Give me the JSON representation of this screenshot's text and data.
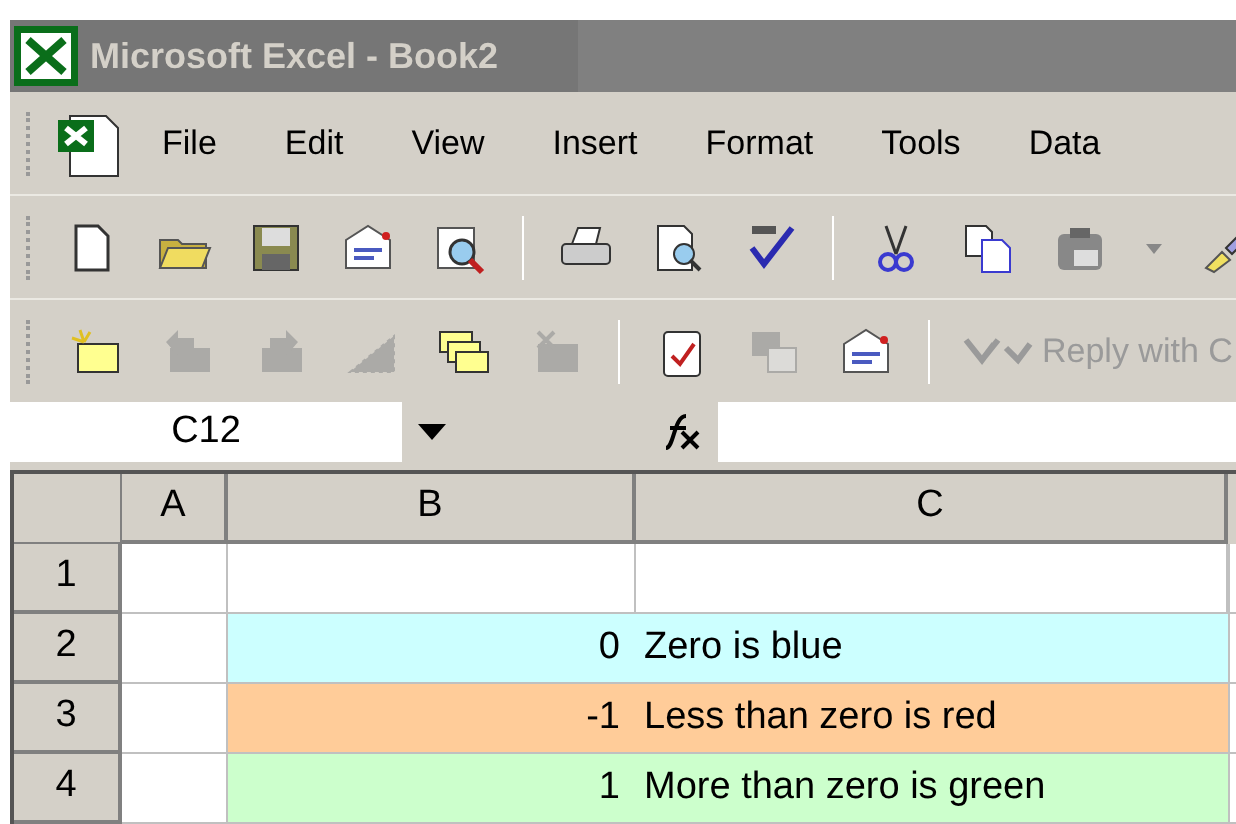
{
  "window": {
    "title": "Microsoft Excel - Book2",
    "active": false
  },
  "menu": [
    "File",
    "Edit",
    "View",
    "Insert",
    "Format",
    "Tools",
    "Data"
  ],
  "toolbar_standard": [
    {
      "kind": "new"
    },
    {
      "kind": "open"
    },
    {
      "kind": "save"
    },
    {
      "kind": "mail"
    },
    {
      "kind": "research"
    },
    {
      "kind": "separator"
    },
    {
      "kind": "print"
    },
    {
      "kind": "preview"
    },
    {
      "kind": "spelling"
    },
    {
      "kind": "separator"
    },
    {
      "kind": "cut"
    },
    {
      "kind": "copy"
    },
    {
      "kind": "paste"
    },
    {
      "kind": "dropdown"
    },
    {
      "kind": "brush"
    }
  ],
  "toolbar_reviewing": [
    {
      "kind": "comment",
      "disabled": false
    },
    {
      "kind": "previous",
      "disabled": true
    },
    {
      "kind": "next",
      "disabled": true
    },
    {
      "kind": "show",
      "disabled": true
    },
    {
      "kind": "showall",
      "disabled": false
    },
    {
      "kind": "delete",
      "disabled": true
    },
    {
      "kind": "separator"
    },
    {
      "kind": "track",
      "disabled": false
    },
    {
      "kind": "protect",
      "disabled": true
    },
    {
      "kind": "mail",
      "disabled": false
    },
    {
      "kind": "separator"
    },
    {
      "kind": "reply",
      "disabled": true,
      "label": "Reply with C"
    }
  ],
  "formula_bar": {
    "name_box": "C12"
  },
  "grid": {
    "columns": [
      "A",
      "B",
      "C"
    ],
    "rows": [
      {
        "number": "1"
      },
      {
        "number": "2",
        "b": "0",
        "c": "Zero is blue",
        "color": "#ccffff"
      },
      {
        "number": "3",
        "b": "-1",
        "c": "Less than zero is red",
        "color": "#ffcc99"
      },
      {
        "number": "4",
        "b": "1",
        "c": "More than zero is green",
        "color": "#ccffcc"
      }
    ]
  }
}
